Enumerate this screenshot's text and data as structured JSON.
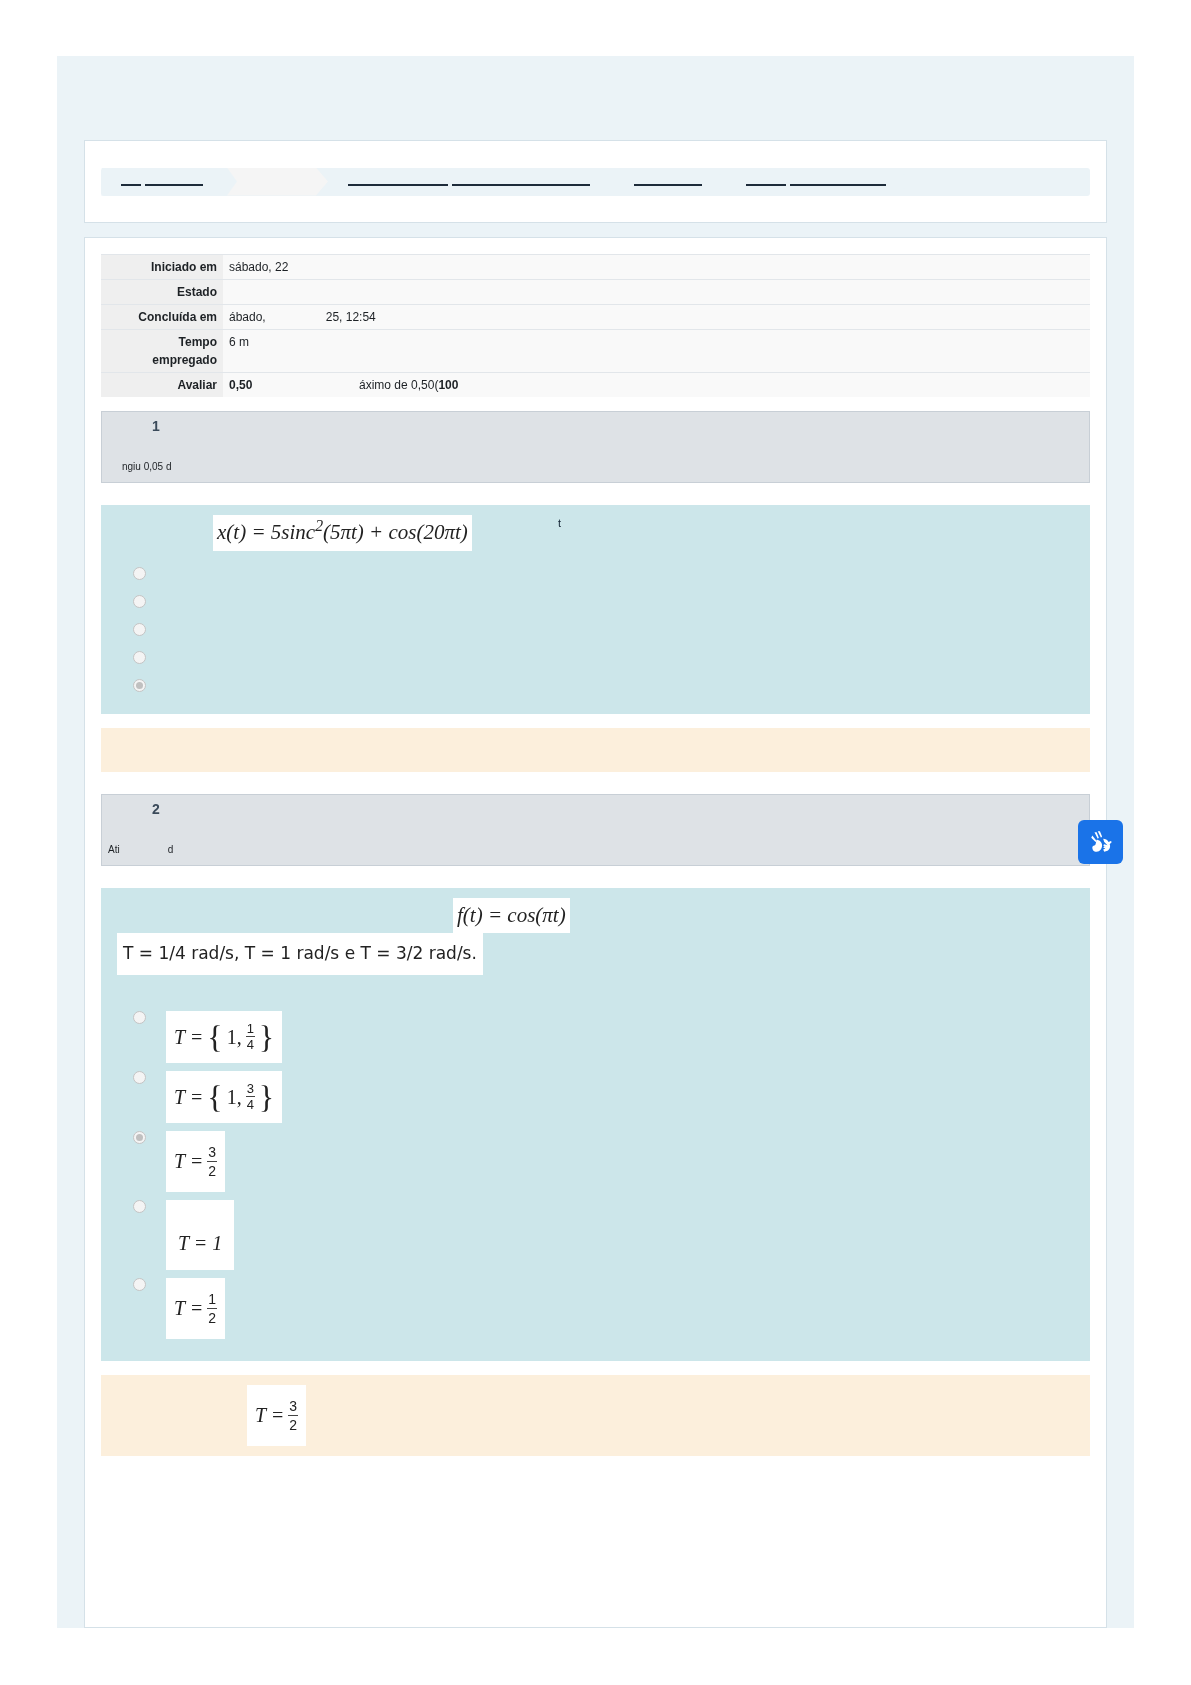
{
  "breadcrumb": [
    {
      "selected": false
    },
    {
      "selected": true
    },
    {
      "selected": false
    },
    {
      "selected": false
    },
    {
      "selected": false
    }
  ],
  "summary": [
    {
      "label": "Iniciado em",
      "value": "sábado, 22"
    },
    {
      "label": "Estado"
    },
    {
      "label": "Concluída em",
      "value": "ábado,",
      "value_2": "25, 12:54"
    },
    {
      "label": "Tempo empregado",
      "value": "6 m"
    },
    {
      "label": "Avaliar",
      "value": "0,50",
      "value_2": "áximo de 0,50(**100**"
    }
  ],
  "questions": [
    {
      "number": "1",
      "info": [
        "ngiu 0,05 d"
      ],
      "prompt": [
        {
          "kind": "math",
          "text": "x(t) = 5sinc$^{2}$(5πt) + cos(20πt)"
        },
        {
          "kind": "word",
          "text": "t"
        }
      ],
      "options": [
        {
          "selected": false
        },
        {
          "selected": false
        },
        {
          "selected": false
        },
        {
          "selected": false
        },
        {
          "selected": true
        }
      ]
    },
    {
      "number": "2",
      "info": [
        "Ati",
        "d"
      ],
      "prompt": [
        {
          "kind": "math",
          "text": "f(t) = cos(πt)"
        },
        {
          "kind": "line",
          "text": "T = 1/4 rad/s, T = 1 rad/s e T = 3/2 rad/s."
        }
      ],
      "options": [
        {
          "selected": false,
          "math": {
            "kind": "set",
            "lhs": "T =",
            "open": "{",
            "whole": "1,",
            "num": "1",
            "den": "4",
            "close": "}"
          }
        },
        {
          "selected": false,
          "math": {
            "kind": "set",
            "lhs": "T =",
            "open": "{",
            "whole": "1,",
            "num": "3",
            "den": "4",
            "close": "}"
          }
        },
        {
          "selected": true,
          "math": {
            "kind": "fraction",
            "lhs": "T =",
            "num": "3",
            "den": "2"
          }
        },
        {
          "selected": false,
          "math": {
            "kind": "plain",
            "text": "T = 1"
          }
        },
        {
          "selected": false,
          "math": {
            "kind": "fraction",
            "lhs": "T =",
            "num": "1",
            "den": "2"
          }
        }
      ],
      "feedback": {
        "kind": "fraction",
        "lhs": "T =",
        "num": "3",
        "den": "2"
      }
    }
  ]
}
